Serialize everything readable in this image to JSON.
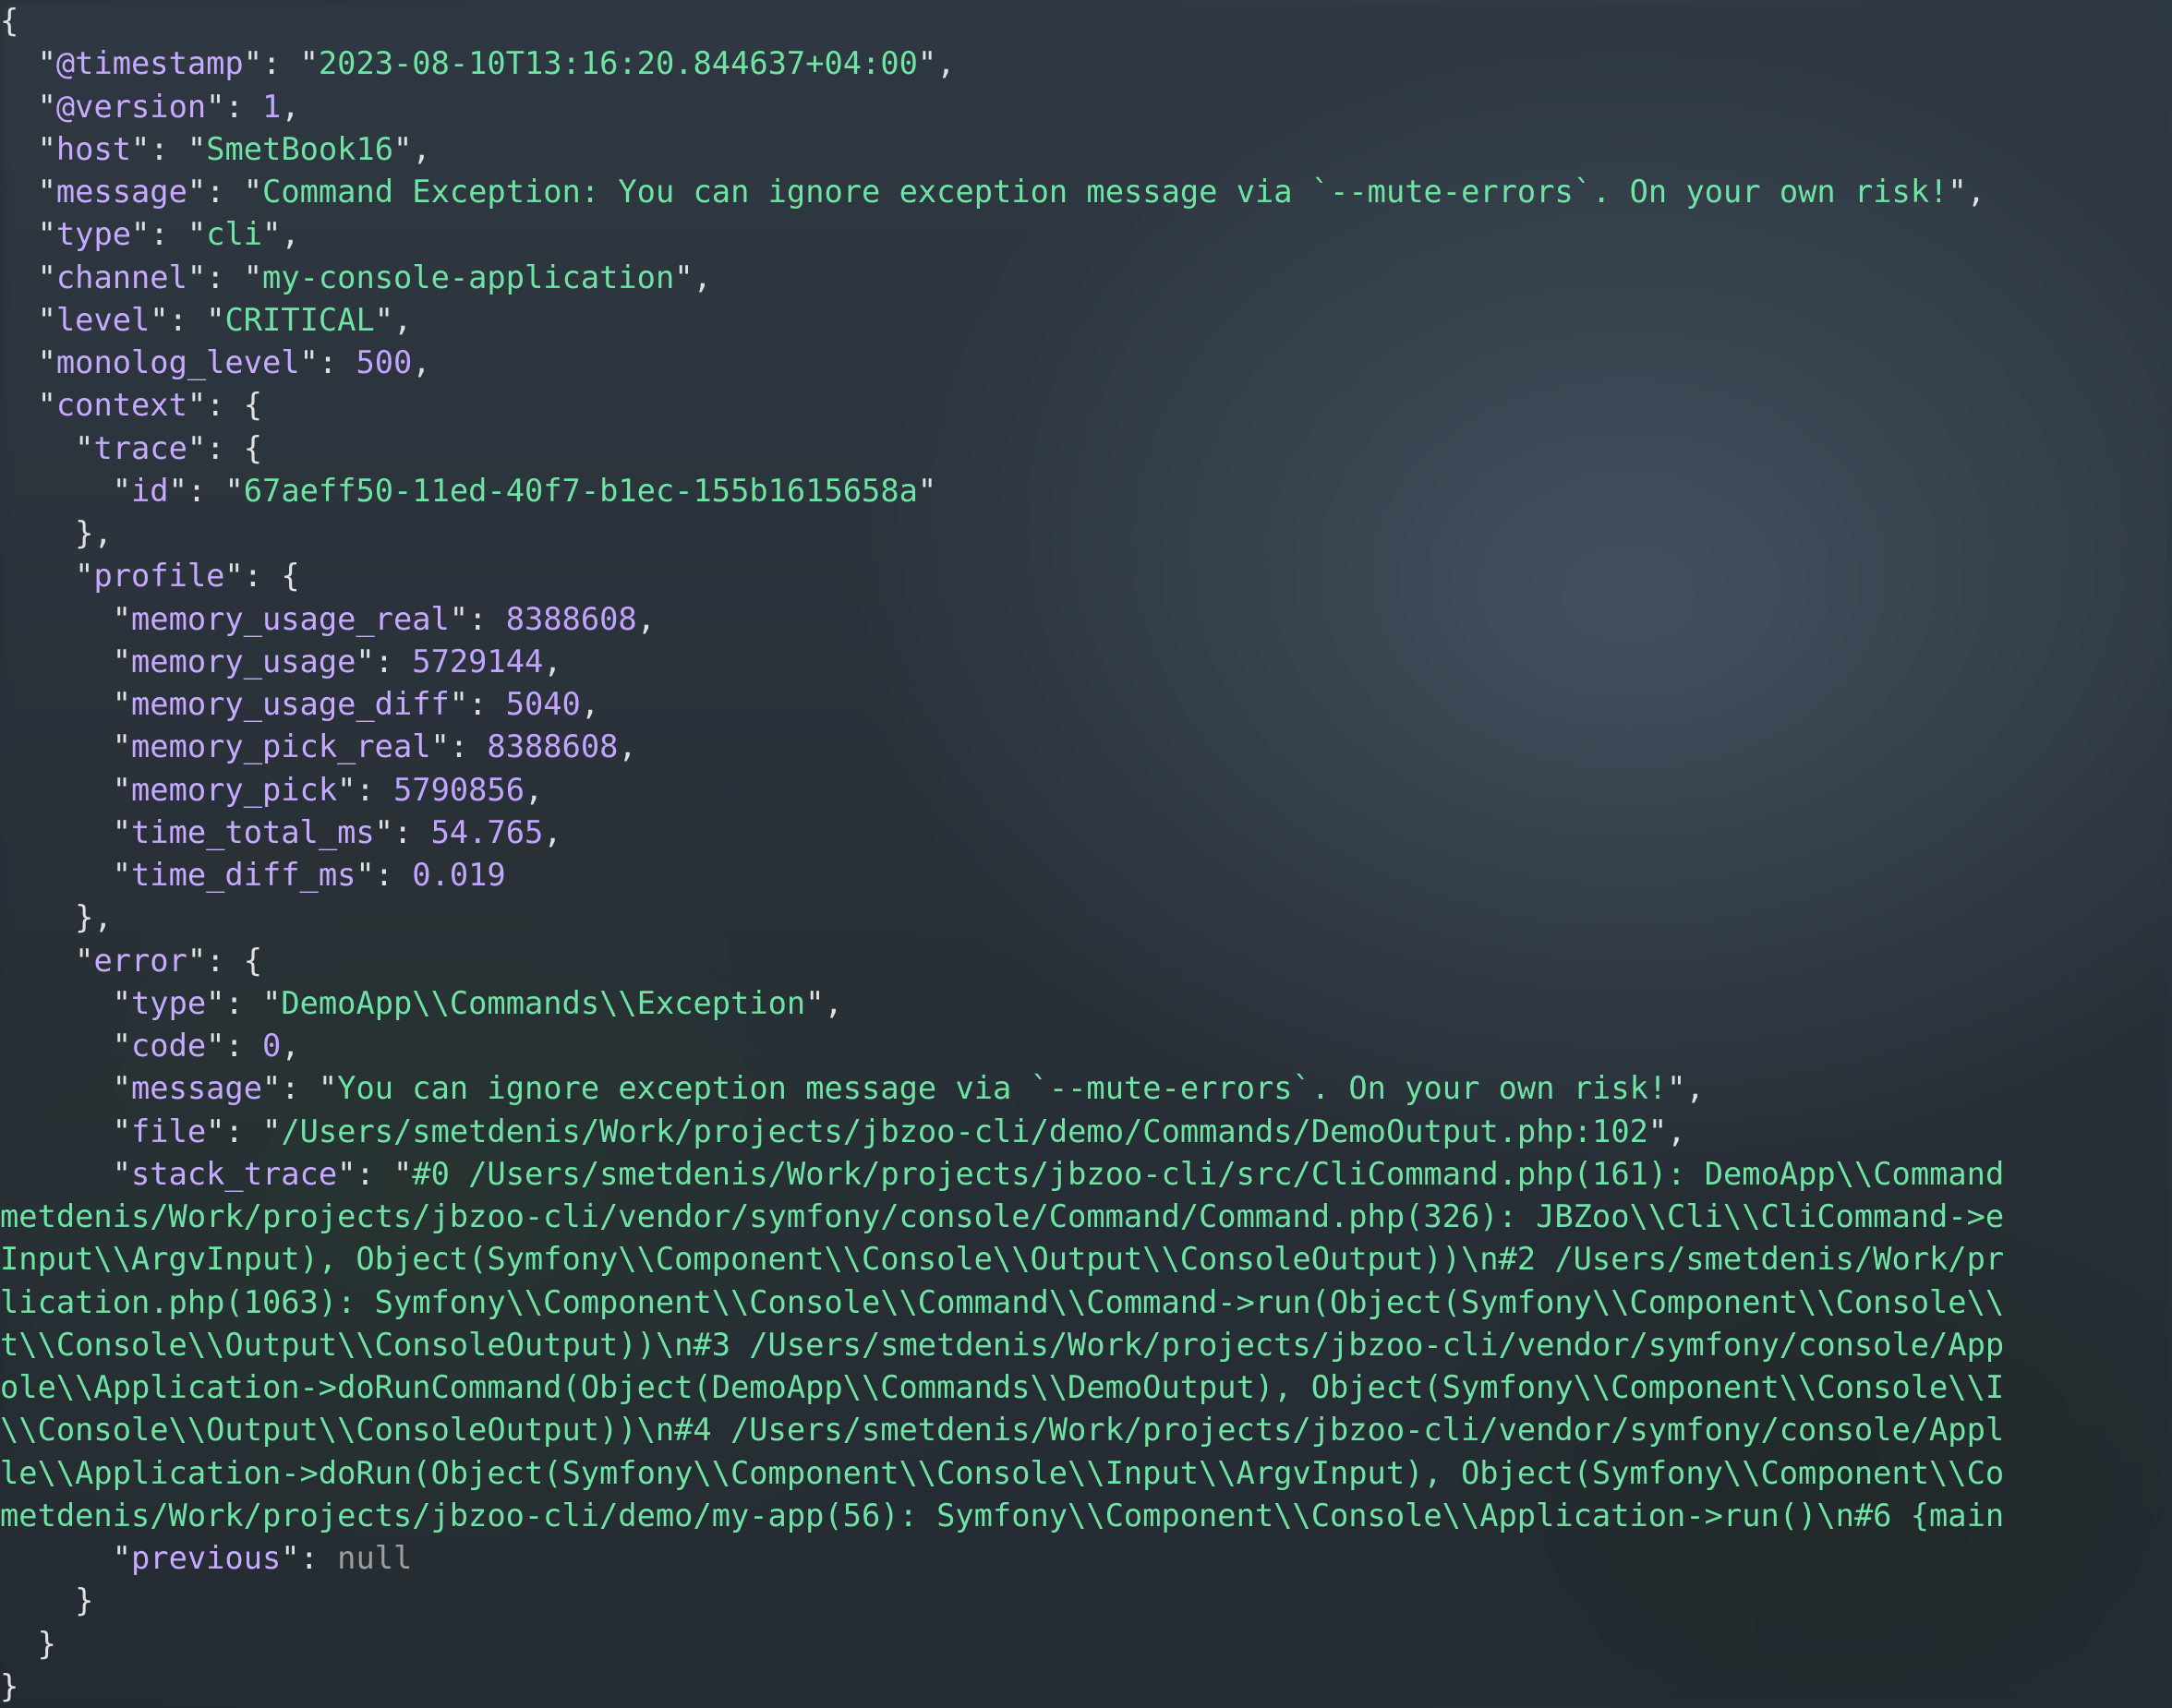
{
  "syntax": {
    "open_brace": "{",
    "close_brace": "}",
    "colon": ":",
    "comma": ",",
    "quote": "\"",
    "null": "null"
  },
  "root": {
    "timestamp_k": "@timestamp",
    "timestamp_v": "2023-08-10T13:16:20.844637+04:00",
    "version_k": "@version",
    "version_v": "1",
    "host_k": "host",
    "host_v": "SmetBook16",
    "message_k": "message",
    "message_v": "Command Exception: You can ignore exception message via `--mute-errors`. On your own risk!",
    "type_k": "type",
    "type_v": "cli",
    "channel_k": "channel",
    "channel_v": "my-console-application",
    "level_k": "level",
    "level_v": "CRITICAL",
    "monolog_level_k": "monolog_level",
    "monolog_level_v": "500",
    "context_k": "context",
    "trace_k": "trace",
    "trace_id_k": "id",
    "trace_id_v": "67aeff50-11ed-40f7-b1ec-155b1615658a",
    "profile_k": "profile",
    "p_mur_k": "memory_usage_real",
    "p_mur_v": "8388608",
    "p_mu_k": "memory_usage",
    "p_mu_v": "5729144",
    "p_mud_k": "memory_usage_diff",
    "p_mud_v": "5040",
    "p_mpr_k": "memory_pick_real",
    "p_mpr_v": "8388608",
    "p_mp_k": "memory_pick",
    "p_mp_v": "5790856",
    "p_ttm_k": "time_total_ms",
    "p_ttm_v": "54.765",
    "p_tdm_k": "time_diff_ms",
    "p_tdm_v": "0.019",
    "error_k": "error",
    "e_type_k": "type",
    "e_type_v": "DemoApp\\\\Commands\\\\Exception",
    "e_code_k": "code",
    "e_code_v": "0",
    "e_msg_k": "message",
    "e_msg_v": "You can ignore exception message via `--mute-errors`. On your own risk!",
    "e_file_k": "file",
    "e_file_v": "/Users/smetdenis/Work/projects/jbzoo-cli/demo/Commands/DemoOutput.php:102",
    "e_st_k": "stack_trace",
    "e_prev_k": "previous"
  },
  "stack_trace_lines": [
    "#0 /Users/smetdenis/Work/projects/jbzoo-cli/src/CliCommand.php(161): DemoApp\\\\Command",
    "metdenis/Work/projects/jbzoo-cli/vendor/symfony/console/Command/Command.php(326): JBZoo\\\\Cli\\\\CliCommand->e",
    "Input\\\\ArgvInput), Object(Symfony\\\\Component\\\\Console\\\\Output\\\\ConsoleOutput))\\n#2 /Users/smetdenis/Work/pr",
    "lication.php(1063): Symfony\\\\Component\\\\Console\\\\Command\\\\Command->run(Object(Symfony\\\\Component\\\\Console\\\\",
    "t\\\\Console\\\\Output\\\\ConsoleOutput))\\n#3 /Users/smetdenis/Work/projects/jbzoo-cli/vendor/symfony/console/App",
    "ole\\\\Application->doRunCommand(Object(DemoApp\\\\Commands\\\\DemoOutput), Object(Symfony\\\\Component\\\\Console\\\\I",
    "\\\\Console\\\\Output\\\\ConsoleOutput))\\n#4 /Users/smetdenis/Work/projects/jbzoo-cli/vendor/symfony/console/Appl",
    "le\\\\Application->doRun(Object(Symfony\\\\Component\\\\Console\\\\Input\\\\ArgvInput), Object(Symfony\\\\Component\\\\Co",
    "metdenis/Work/projects/jbzoo-cli/demo/my-app(56): Symfony\\\\Component\\\\Console\\\\Application->run()\\n#6 {main"
  ]
}
